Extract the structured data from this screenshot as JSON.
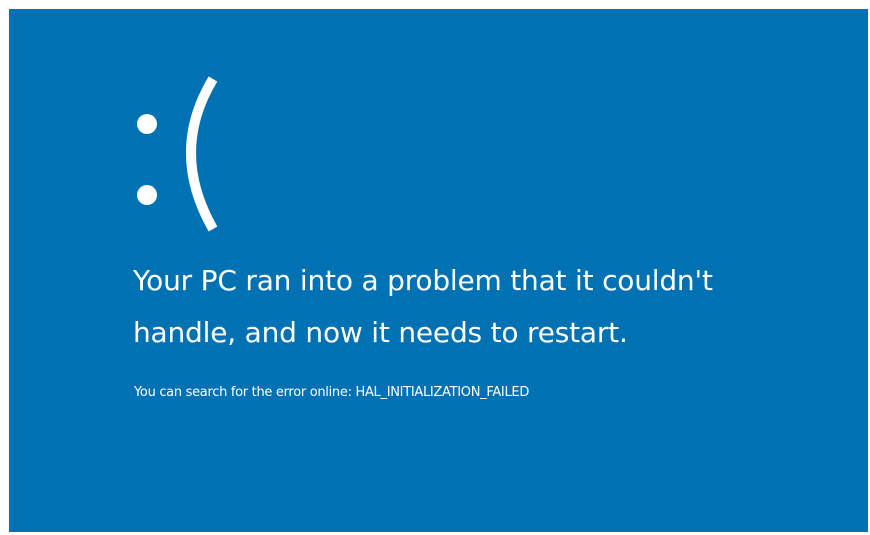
{
  "screen": {
    "background_color": "#0072b4",
    "text_color": "#ffffff",
    "emoticon": ":(",
    "headline_lines": [
      "Your PC ran into a problem that it couldn't",
      "handle, and now it needs to restart."
    ],
    "search_hint": "You can search for the error online: HAL_INITIALIZATION_FAILED"
  }
}
